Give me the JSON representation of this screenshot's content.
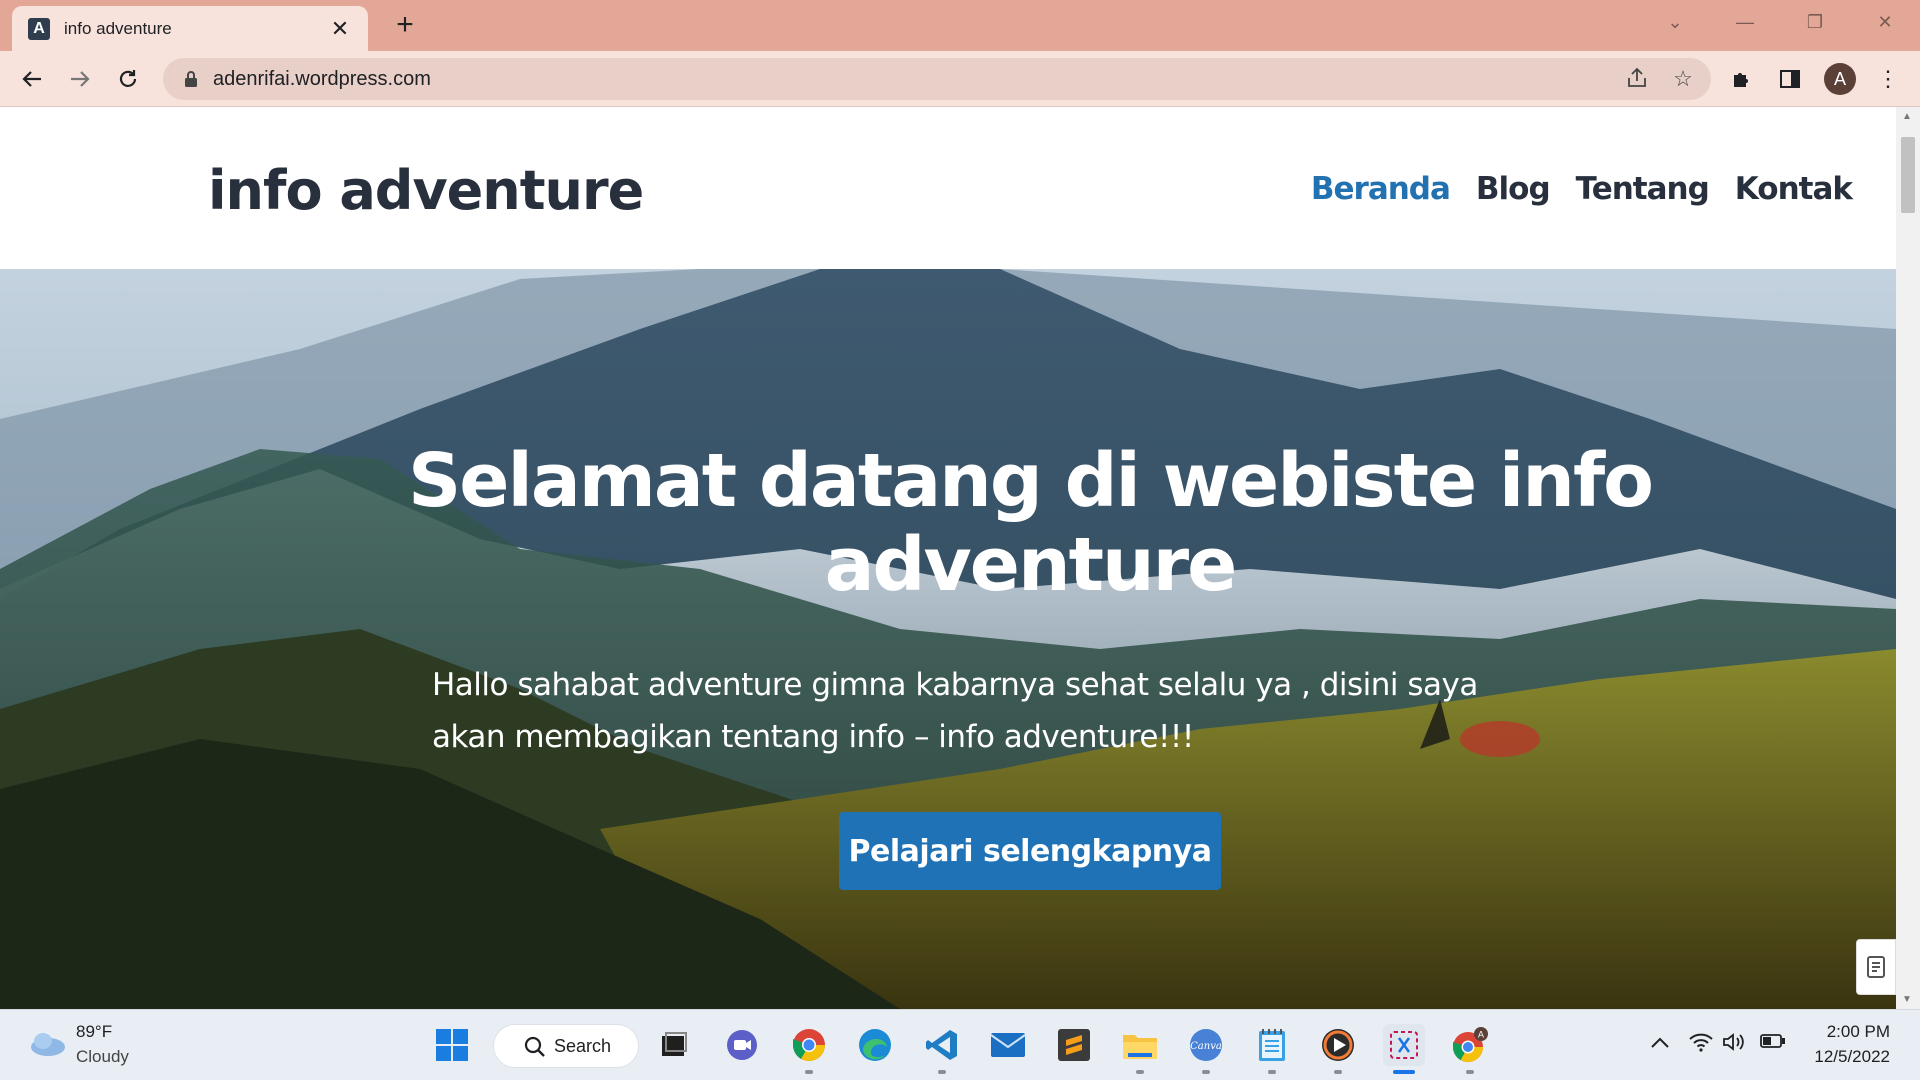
{
  "browser": {
    "tab_title": "info adventure",
    "new_tab_symbol": "+",
    "url": "adenrifai.wordpress.com",
    "profile_initial": "A"
  },
  "site": {
    "title": "info adventure",
    "nav": [
      {
        "label": "Beranda",
        "active": true
      },
      {
        "label": "Blog",
        "active": false
      },
      {
        "label": "Tentang",
        "active": false
      },
      {
        "label": "Kontak",
        "active": false
      }
    ],
    "hero": {
      "title": "Selamat datang di webiste info adventure",
      "text": "Hallo sahabat adventure gimna kabarnya sehat selalu ya , disini saya akan membagikan tentang info – info adventure!!!",
      "button_label": "Pelajari selengkapnya"
    }
  },
  "taskbar": {
    "weather_temp": "89°F",
    "weather_condition": "Cloudy",
    "search_label": "Search",
    "time": "2:00 PM",
    "date": "12/5/2022",
    "apps": [
      "task-view",
      "teams-chat",
      "chrome",
      "edge",
      "vscode",
      "mail",
      "sublime-text",
      "file-explorer",
      "canva",
      "notepad",
      "media-player",
      "snipping-tool",
      "chrome-profile"
    ]
  },
  "colors": {
    "accent": "#2271b1",
    "button": "#1f72b6",
    "titlebar": "#e3a797",
    "toolbar": "#f7e2dc"
  }
}
